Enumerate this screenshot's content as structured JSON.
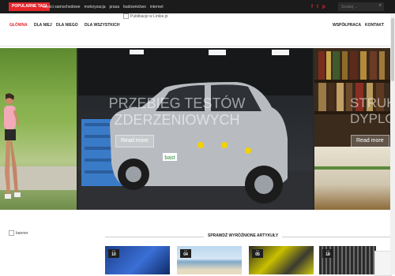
{
  "topbar": {
    "badge": "POPULARNE TAGI",
    "tags": [
      "części samochodowe",
      "motoryzacja",
      "prasa",
      "budownictwo",
      "internet"
    ],
    "social": [
      "f",
      "t",
      "p"
    ],
    "search_placeholder": "Szukaj ..."
  },
  "logo": {
    "alt": "Publikacje w Linkie.pl"
  },
  "nav": {
    "left": [
      "GŁÓWNA",
      "DLA NIEJ",
      "DLA NIEGO",
      "DLA WSZYSTKICH"
    ],
    "right": [
      "WSPÓŁPRACA",
      "KONTAKT"
    ]
  },
  "slider": {
    "center": {
      "title_line1": "PRZEBIEG TESTÓW",
      "title_line2": "ZDERZENIOWYCH",
      "button": "Read more"
    },
    "right": {
      "title_line1": "STRUK",
      "title_line2": "DYPLO",
      "button": "Read more"
    },
    "car_brand": "bast"
  },
  "banner": {
    "alt": "banner"
  },
  "section": {
    "title": "SPRAWDŹ WYRÓŻNIONE ARTYKUŁY",
    "articles": [
      {
        "month": "Lut",
        "day": "10"
      },
      {
        "month": "Lut",
        "day": "04"
      },
      {
        "month": "Lut",
        "day": "05"
      },
      {
        "month": "Lut",
        "day": "18"
      }
    ]
  },
  "colors": {
    "accent": "#e4262b",
    "topbar": "#1b1b1b"
  }
}
